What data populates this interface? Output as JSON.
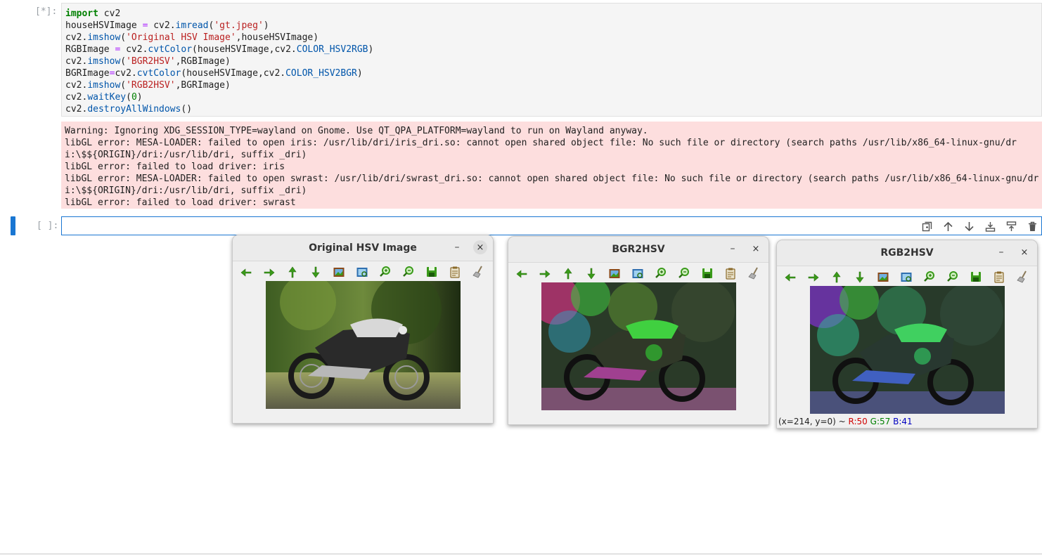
{
  "cell1": {
    "prompt": "[*]:",
    "code_lines": [
      "import cv2",
      "houseHSVImage = cv2.imread('gt.jpeg')",
      "cv2.imshow('Original HSV Image',houseHSVImage)",
      "RGBImage = cv2.cvtColor(houseHSVImage,cv2.COLOR_HSV2RGB)",
      "cv2.imshow('BGR2HSV',RGBImage)",
      "BGRImage=cv2.cvtColor(houseHSVImage,cv2.COLOR_HSV2BGR)",
      "cv2.imshow('RGB2HSV',BGRImage)",
      "cv2.waitKey(0)",
      "cv2.destroyAllWindows()"
    ],
    "stderr_lines": [
      "Warning: Ignoring XDG_SESSION_TYPE=wayland on Gnome. Use QT_QPA_PLATFORM=wayland to run on Wayland anyway.",
      "libGL error: MESA-LOADER: failed to open iris: /usr/lib/dri/iris_dri.so: cannot open shared object file: No such file or directory (search paths /usr/lib/x86_64-linux-gnu/dr",
      "i:\\$${ORIGIN}/dri:/usr/lib/dri, suffix _dri)",
      "libGL error: failed to load driver: iris",
      "libGL error: MESA-LOADER: failed to open swrast: /usr/lib/dri/swrast_dri.so: cannot open shared object file: No such file or directory (search paths /usr/lib/x86_64-linux-gnu/dr",
      "i:\\$${ORIGIN}/dri:/usr/lib/dri, suffix _dri)",
      "libGL error: failed to load driver: swrast"
    ]
  },
  "cell2": {
    "prompt": "[ ]:",
    "value": ""
  },
  "cell_toolbar_icons": [
    "duplicate-icon",
    "move-up-icon",
    "move-down-icon",
    "insert-below-icon",
    "insert-above-icon",
    "delete-icon"
  ],
  "windows": [
    {
      "title": "Original HSV Image",
      "minimize": "–",
      "close": "×",
      "status": ""
    },
    {
      "title": "BGR2HSV",
      "minimize": "–",
      "close": "×",
      "status": ""
    },
    {
      "title": "RGB2HSV",
      "minimize": "–",
      "close": "×",
      "status_prefix": "(x=214, y=0) ~ ",
      "status_r": "R:50",
      "status_g": "G:57",
      "status_b": "B:41"
    }
  ],
  "window_tools": [
    "pan-left-icon",
    "pan-right-icon",
    "pan-up-icon",
    "pan-down-icon",
    "zoom-fit-icon",
    "zoom-region-icon",
    "zoom-in-icon",
    "zoom-out-icon",
    "save-icon",
    "properties-icon",
    "clear-icon"
  ],
  "colors": {
    "accent": "#1976d2",
    "stderr_bg": "#fddede",
    "status_r": "#d00000",
    "status_g": "#008000",
    "status_b": "#0000c0"
  }
}
